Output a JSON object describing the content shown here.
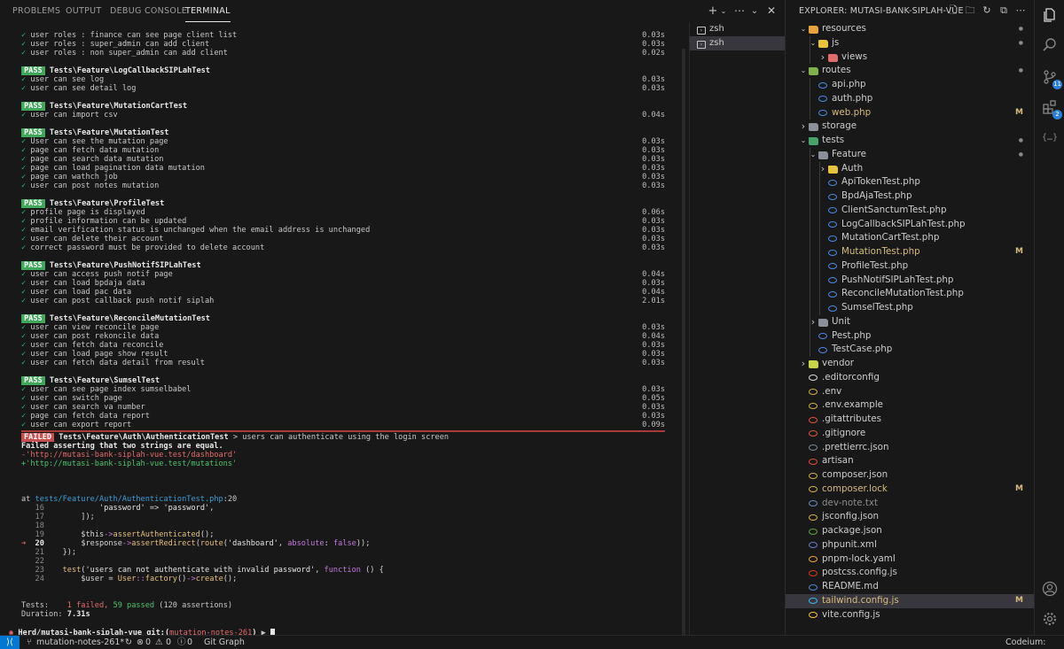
{
  "panel": {
    "tabs": [
      "PROBLEMS",
      "OUTPUT",
      "DEBUG CONSOLE",
      "TERMINAL"
    ],
    "active_tab": "TERMINAL"
  },
  "terminal": {
    "shells": [
      "zsh",
      "zsh"
    ],
    "pass_badge": "PASS",
    "fail_badge": "FAILED",
    "check": "✓",
    "groups": [
      {
        "title": null,
        "tests": [
          {
            "name": "user roles : finance can see page client list",
            "time": "0.03s"
          },
          {
            "name": "user roles : super_admin can add client",
            "time": "0.03s"
          },
          {
            "name": "user roles : non super_admin can add client",
            "time": "0.02s"
          }
        ]
      },
      {
        "title": "Tests\\Feature\\LogCallbackSIPLahTest",
        "tests": [
          {
            "name": "user can see log",
            "time": "0.03s"
          },
          {
            "name": "user can see detail log",
            "time": "0.03s"
          }
        ]
      },
      {
        "title": "Tests\\Feature\\MutationCartTest",
        "tests": [
          {
            "name": "user can import csv",
            "time": "0.04s"
          }
        ]
      },
      {
        "title": "Tests\\Feature\\MutationTest",
        "tests": [
          {
            "name": "User can see the mutation page",
            "time": "0.03s"
          },
          {
            "name": "page can fetch data mutation",
            "time": "0.03s"
          },
          {
            "name": "page can search data mutation",
            "time": "0.03s"
          },
          {
            "name": "page can load pagination data mutation",
            "time": "0.03s"
          },
          {
            "name": "page can wathch job",
            "time": "0.03s"
          },
          {
            "name": "user can post notes mutation",
            "time": "0.03s"
          }
        ]
      },
      {
        "title": "Tests\\Feature\\ProfileTest",
        "tests": [
          {
            "name": "profile page is displayed",
            "time": "0.06s"
          },
          {
            "name": "profile information can be updated",
            "time": "0.03s"
          },
          {
            "name": "email verification status is unchanged when the email address is unchanged",
            "time": "0.03s"
          },
          {
            "name": "user can delete their account",
            "time": "0.03s"
          },
          {
            "name": "correct password must be provided to delete account",
            "time": "0.03s"
          }
        ]
      },
      {
        "title": "Tests\\Feature\\PushNotifSIPLahTest",
        "tests": [
          {
            "name": "user can access push notif page",
            "time": "0.04s"
          },
          {
            "name": "user can load bpdaja data",
            "time": "0.03s"
          },
          {
            "name": "user can load pac data",
            "time": "0.04s"
          },
          {
            "name": "user can post callback push notif siplah",
            "time": "2.01s"
          }
        ]
      },
      {
        "title": "Tests\\Feature\\ReconcileMutationTest",
        "tests": [
          {
            "name": "user can view reconcile page",
            "time": "0.03s"
          },
          {
            "name": "user can post rekoncile data",
            "time": "0.04s"
          },
          {
            "name": "user can fetch data reconcile",
            "time": "0.03s"
          },
          {
            "name": "user can load page show result",
            "time": "0.03s"
          },
          {
            "name": "user can fetch data detail from result",
            "time": "0.03s"
          }
        ]
      },
      {
        "title": "Tests\\Feature\\SumselTest",
        "tests": [
          {
            "name": "user can see page index sumselbabel",
            "time": "0.03s"
          },
          {
            "name": "user can switch page",
            "time": "0.05s"
          },
          {
            "name": "user can search va number",
            "time": "0.03s"
          },
          {
            "name": "page can fetch data report",
            "time": "0.03s"
          },
          {
            "name": "user can export report",
            "time": "0.09s"
          }
        ]
      }
    ],
    "failure": {
      "test_class": "Tests\\Feature\\Auth\\AuthenticationTest",
      "separator": ">",
      "test_name": "users can authenticate using the login screen",
      "message": "Failed asserting that two strings are equal.",
      "expected": "-'http://mutasi-bank-siplah-vue.test/dashboard'",
      "actual": "+'http://mutasi-bank-siplah-vue.test/mutations'",
      "at_label": "at",
      "file": "tests/Feature/Auth/AuthenticationTest.php",
      "line": ":20",
      "code": [
        {
          "n": "16",
          "segs": [
            [
              "var",
              "            "
            ],
            [
              "str",
              "'password'"
            ],
            [
              "var",
              " => "
            ],
            [
              "str",
              "'password'"
            ],
            [
              "var",
              ","
            ]
          ]
        },
        {
          "n": "17",
          "segs": [
            [
              "var",
              "        ]);"
            ]
          ]
        },
        {
          "n": "18",
          "segs": []
        },
        {
          "n": "19",
          "segs": [
            [
              "var",
              "        "
            ],
            [
              "var",
              "$this"
            ],
            [
              "kw",
              "->"
            ],
            [
              "fn",
              "assertAuthenticated"
            ],
            [
              "var",
              "();"
            ]
          ]
        },
        {
          "n": "20",
          "arrow": "➜",
          "segs": [
            [
              "var",
              "        "
            ],
            [
              "var",
              "$response"
            ],
            [
              "kw",
              "->"
            ],
            [
              "fn",
              "assertRedirect"
            ],
            [
              "var",
              "("
            ],
            [
              "fn",
              "route"
            ],
            [
              "var",
              "("
            ],
            [
              "str",
              "'dashboard'"
            ],
            [
              "var",
              ", "
            ],
            [
              "kw",
              "absolute"
            ],
            [
              "var",
              ": "
            ],
            [
              "kw",
              "false"
            ],
            [
              "var",
              "));"
            ]
          ]
        },
        {
          "n": "21",
          "segs": [
            [
              "var",
              "    });"
            ]
          ]
        },
        {
          "n": "22",
          "segs": []
        },
        {
          "n": "23",
          "segs": [
            [
              "var",
              "    "
            ],
            [
              "fn",
              "test"
            ],
            [
              "var",
              "("
            ],
            [
              "str",
              "'users can not authenticate with invalid password'"
            ],
            [
              "var",
              ", "
            ],
            [
              "kw",
              "function"
            ],
            [
              "var",
              " () {"
            ]
          ]
        },
        {
          "n": "24",
          "segs": [
            [
              "var",
              "        "
            ],
            [
              "var",
              "$user"
            ],
            [
              "var",
              " = "
            ],
            [
              "fn",
              "User"
            ],
            [
              "kw",
              "::"
            ],
            [
              "fn",
              "factory"
            ],
            [
              "var",
              "()"
            ],
            [
              "kw",
              "->"
            ],
            [
              "fn",
              "create"
            ],
            [
              "var",
              "();"
            ]
          ]
        }
      ]
    },
    "summary": {
      "tests_label": "Tests:",
      "failed": "1 failed,",
      "passed": "59 passed",
      "assertions": "(120 assertions)",
      "duration_label": "Duration:",
      "duration": "7.31s"
    },
    "prompt": {
      "dir": "Herd/mutasi-bank-siplah-vue",
      "git": "git:(",
      "branch": "mutation-notes-261",
      "git_close": ")",
      "arrow": "▶"
    }
  },
  "explorer": {
    "title": "EXPLORER: MUTASI-BANK-SIPLAH-VUE",
    "items": [
      {
        "label": "resources",
        "depth": 0,
        "kind": "folder-open",
        "color": "#e8a33d",
        "status": "dot"
      },
      {
        "label": "js",
        "depth": 1,
        "kind": "folder-open",
        "color": "#e8c43d",
        "status": "dot"
      },
      {
        "label": "views",
        "depth": 2,
        "kind": "folder",
        "color": "#e06c6c"
      },
      {
        "label": "routes",
        "depth": 0,
        "kind": "folder-open",
        "color": "#7fb34a",
        "status": "dot"
      },
      {
        "label": "api.php",
        "depth": 1,
        "kind": "file",
        "color": "#4b8ce0"
      },
      {
        "label": "auth.php",
        "depth": 1,
        "kind": "file",
        "color": "#4b8ce0"
      },
      {
        "label": "web.php",
        "depth": 1,
        "kind": "file",
        "color": "#4b8ce0",
        "status": "M",
        "modified": true
      },
      {
        "label": "storage",
        "depth": 0,
        "kind": "folder",
        "color": "#8a8f99"
      },
      {
        "label": "tests",
        "depth": 0,
        "kind": "folder-open",
        "color": "#47a26a",
        "status": "dot"
      },
      {
        "label": "Feature",
        "depth": 1,
        "kind": "folder-open",
        "color": "#8a8f99",
        "status": "dot"
      },
      {
        "label": "Auth",
        "depth": 2,
        "kind": "folder",
        "color": "#e8c43d"
      },
      {
        "label": "ApiTokenTest.php",
        "depth": 2,
        "kind": "file",
        "color": "#4b8ce0"
      },
      {
        "label": "BpdAjaTest.php",
        "depth": 2,
        "kind": "file",
        "color": "#4b8ce0"
      },
      {
        "label": "ClientSanctumTest.php",
        "depth": 2,
        "kind": "file",
        "color": "#4b8ce0"
      },
      {
        "label": "LogCallbackSIPLahTest.php",
        "depth": 2,
        "kind": "file",
        "color": "#4b8ce0"
      },
      {
        "label": "MutationCartTest.php",
        "depth": 2,
        "kind": "file",
        "color": "#4b8ce0"
      },
      {
        "label": "MutationTest.php",
        "depth": 2,
        "kind": "file",
        "color": "#4b8ce0",
        "status": "M",
        "modified": true
      },
      {
        "label": "ProfileTest.php",
        "depth": 2,
        "kind": "file",
        "color": "#4b8ce0"
      },
      {
        "label": "PushNotifSIPLahTest.php",
        "depth": 2,
        "kind": "file",
        "color": "#4b8ce0"
      },
      {
        "label": "ReconcileMutationTest.php",
        "depth": 2,
        "kind": "file",
        "color": "#4b8ce0"
      },
      {
        "label": "SumselTest.php",
        "depth": 2,
        "kind": "file",
        "color": "#4b8ce0"
      },
      {
        "label": "Unit",
        "depth": 1,
        "kind": "folder",
        "color": "#8a8f99"
      },
      {
        "label": "Pest.php",
        "depth": 1,
        "kind": "file",
        "color": "#4b8ce0"
      },
      {
        "label": "TestCase.php",
        "depth": 1,
        "kind": "file",
        "color": "#4b8ce0"
      },
      {
        "label": "vendor",
        "depth": 0,
        "kind": "folder",
        "color": "#c9d34a"
      },
      {
        "label": ".editorconfig",
        "depth": 0,
        "kind": "file",
        "color": "#e0e0e0"
      },
      {
        "label": ".env",
        "depth": 0,
        "kind": "file",
        "color": "#d8b24a"
      },
      {
        "label": ".env.example",
        "depth": 0,
        "kind": "file",
        "color": "#d8b24a"
      },
      {
        "label": ".gitattributes",
        "depth": 0,
        "kind": "file",
        "color": "#e2563b"
      },
      {
        "label": ".gitignore",
        "depth": 0,
        "kind": "file",
        "color": "#e2563b"
      },
      {
        "label": ".prettierrc.json",
        "depth": 0,
        "kind": "file",
        "color": "#7b8c99"
      },
      {
        "label": "artisan",
        "depth": 0,
        "kind": "file",
        "color": "#e0503e"
      },
      {
        "label": "composer.json",
        "depth": 0,
        "kind": "file",
        "color": "#d8b24a"
      },
      {
        "label": "composer.lock",
        "depth": 0,
        "kind": "file",
        "color": "#d8b24a",
        "status": "M",
        "modified": true
      },
      {
        "label": "dev-note.txt",
        "depth": 0,
        "kind": "file",
        "color": "#6a8fc0",
        "dim": true
      },
      {
        "label": "jsconfig.json",
        "depth": 0,
        "kind": "file",
        "color": "#d8b24a"
      },
      {
        "label": "package.json",
        "depth": 0,
        "kind": "file",
        "color": "#5fa83e"
      },
      {
        "label": "phpunit.xml",
        "depth": 0,
        "kind": "file",
        "color": "#6b7fd0"
      },
      {
        "label": "pnpm-lock.yaml",
        "depth": 0,
        "kind": "file",
        "color": "#f2a93b"
      },
      {
        "label": "postcss.config.js",
        "depth": 0,
        "kind": "file",
        "color": "#dd3a0a"
      },
      {
        "label": "README.md",
        "depth": 0,
        "kind": "file",
        "color": "#4b8ce0"
      },
      {
        "label": "tailwind.config.js",
        "depth": 0,
        "kind": "file",
        "color": "#38bdf8",
        "status": "M",
        "modified": true,
        "selected": true
      },
      {
        "label": "vite.config.js",
        "depth": 0,
        "kind": "file",
        "color": "#ffc63a"
      }
    ]
  },
  "activity": {
    "icons": [
      "explorer-icon",
      "search-icon",
      "source-control-icon",
      "extensions-icon",
      "bracket-icon"
    ],
    "badges": {
      "source_control": "11",
      "extensions": "2"
    }
  },
  "status_bar": {
    "branch": "mutation-notes-261*",
    "errors": "0",
    "warnings": "0",
    "info": "0",
    "git_graph": "Git Graph",
    "codeium": "Codeium: {...}"
  },
  "colors": {
    "pass": "#3fa85a",
    "fail": "#c74e4e",
    "accent": "#0078d4",
    "modified": "#d7ba7d"
  }
}
